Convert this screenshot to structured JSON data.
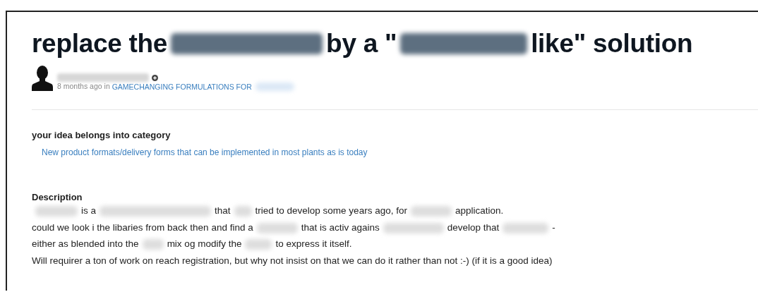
{
  "title": [
    {
      "kind": "text",
      "text": "replace the"
    },
    {
      "kind": "redacted"
    },
    {
      "kind": "text",
      "text": "by a \""
    },
    {
      "kind": "redacted"
    },
    {
      "kind": "text",
      "text": "like\" solution"
    }
  ],
  "author": {
    "name": {
      "kind": "redacted"
    }
  },
  "meta": {
    "time": "8 months ago in",
    "group": [
      {
        "kind": "text",
        "text": "GAMECHANGING FORMULATIONS FOR"
      },
      {
        "kind": "redacted"
      }
    ]
  },
  "category": {
    "heading": "your idea belongs into category",
    "value": "New product formats/delivery forms that can be implemented in most plants as is today"
  },
  "description": {
    "heading": "Description",
    "lines": [
      [
        {
          "kind": "redacted"
        },
        {
          "kind": "text",
          "text": "is a"
        },
        {
          "kind": "redacted"
        },
        {
          "kind": "text",
          "text": "that"
        },
        {
          "kind": "redacted"
        },
        {
          "kind": "text",
          "text": "tried to develop some years ago, for"
        },
        {
          "kind": "redacted"
        },
        {
          "kind": "text",
          "text": "application."
        }
      ],
      [
        {
          "kind": "text",
          "text": "could we look i the libaries from back then and find a"
        },
        {
          "kind": "redacted"
        },
        {
          "kind": "text",
          "text": "that is activ agains"
        },
        {
          "kind": "redacted"
        },
        {
          "kind": "text",
          "text": "develop that"
        },
        {
          "kind": "redacted"
        },
        {
          "kind": "text",
          "text": "-"
        }
      ],
      [
        {
          "kind": "text",
          "text": "either as blended into the"
        },
        {
          "kind": "redacted"
        },
        {
          "kind": "text",
          "text": "mix og modify the"
        },
        {
          "kind": "redacted"
        },
        {
          "kind": "text",
          "text": "to express it itself."
        }
      ],
      [
        {
          "kind": "text",
          "text": "Will requirer a ton of work on reach registration, but why not insist on that we can do it rather than not :-) (if it is a good idea)"
        }
      ]
    ]
  }
}
